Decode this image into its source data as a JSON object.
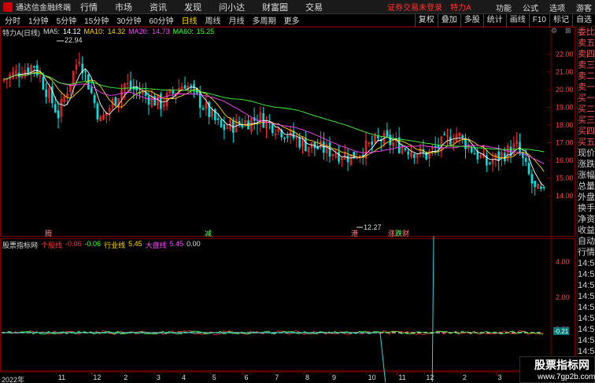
{
  "menubar": {
    "app_title": "通达信金融终端",
    "items": [
      "行情",
      "市场",
      "资讯",
      "发现",
      "问小达",
      "财富圈",
      "交易"
    ],
    "warning": "证券交易未登录",
    "stock": "特力A",
    "right": [
      "功能",
      "公式",
      "选项",
      "游客"
    ]
  },
  "toolbar": {
    "periods": [
      "分时",
      "1分钟",
      "5分钟",
      "15分钟",
      "30分钟",
      "60分钟",
      "日线",
      "周线",
      "月线",
      "多周期",
      "更多"
    ],
    "active": "日线",
    "right_tools": [
      "复权",
      "叠加",
      "多股",
      "统计",
      "画线",
      "F10",
      "标记",
      "自选"
    ]
  },
  "infobar": {
    "name": "特力A(日线)",
    "ma5_label": "MA5:",
    "ma5": "14.12",
    "ma10_label": "MA10:",
    "ma10": "14.32",
    "ma20_label": "MA20:",
    "ma20": "14.73",
    "ma60_label": "MA60:",
    "ma60": "15.25"
  },
  "price_axis": [
    "22.00",
    "21.00",
    "20.00",
    "19.00",
    "18.00",
    "17.00",
    "16.00",
    "15.00",
    "14.00"
  ],
  "annotations": {
    "high": "22.94",
    "low": "12.27"
  },
  "events": [
    "腾",
    "减",
    "港",
    "涨",
    "跌",
    "财"
  ],
  "indicator": {
    "name": "股票指标网",
    "l1_label": "个股线",
    "l1": "-0.06",
    "l2": "-0.06",
    "l3_label": "行业线",
    "l3": "5.45",
    "l4_label": "大盘线",
    "l4": "5.45",
    "l5": "0.00"
  },
  "ind_axis": [
    "4.00",
    "2.00",
    "0.21",
    "-2.00"
  ],
  "value_tag": "-0.21",
  "date_axis": [
    "2022年",
    "11",
    "12",
    "2",
    "3",
    "4",
    "5",
    "6",
    "7",
    "8",
    "9",
    "10",
    "11",
    "12",
    "2",
    "3",
    "4",
    "5",
    "6"
  ],
  "sidepanel": [
    "委比",
    "卖五",
    "卖四",
    "卖三",
    "卖二",
    "卖一",
    "买一",
    "买二",
    "买三",
    "买四",
    "买五",
    "现价",
    "涨跌",
    "涨幅",
    "总量",
    "外盘",
    "换手",
    "净资",
    "收益",
    "",
    "自动",
    "行情",
    "14:5",
    "14:5",
    "14:5",
    "14:5",
    "14:5",
    "14:5",
    "14:5",
    "14:5",
    "14:5"
  ],
  "watermark": {
    "line1": "股票指标网",
    "line2": "www.7gp2b.com"
  },
  "colors": {
    "up": "#ff3030",
    "down": "#00e0e0",
    "ma5": "#ffffff",
    "ma10": "#ffd700",
    "ma20": "#ff40ff",
    "ma60": "#40ff40"
  }
}
